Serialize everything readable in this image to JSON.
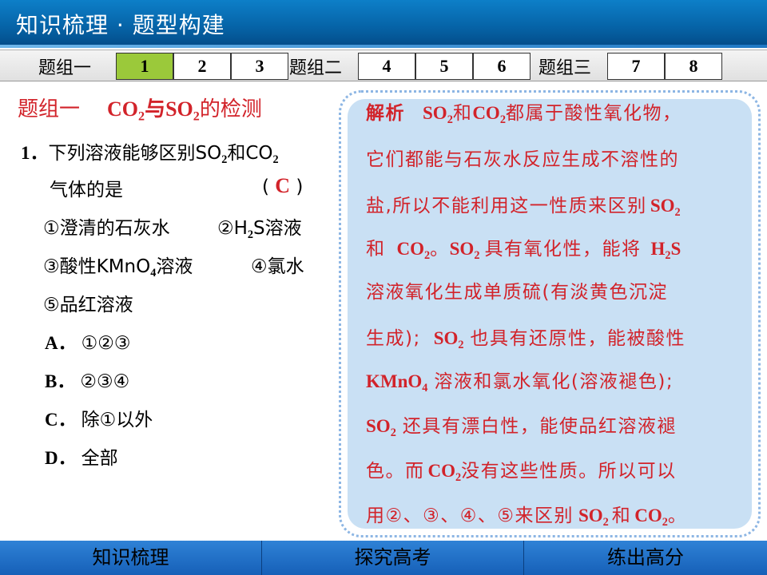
{
  "header": {
    "title": "知识梳理 · 题型构建"
  },
  "tabbar": {
    "groups": [
      {
        "label": "题组一",
        "tabs": [
          "1",
          "2",
          "3"
        ]
      },
      {
        "label": "题组二",
        "tabs": [
          "4",
          "5",
          "6"
        ]
      },
      {
        "label": "题组三",
        "tabs": [
          "7",
          "8"
        ]
      }
    ],
    "active_tab": "1"
  },
  "section": {
    "group": "题组一",
    "title_pre": "CO",
    "title_sub1": "2",
    "title_mid": "与SO",
    "title_sub2": "2",
    "title_post": "的检测"
  },
  "question": {
    "number": "1．",
    "stem_a": "下列溶液能够区别SO",
    "stem_sub1": "2",
    "stem_b": "和CO",
    "stem_sub2": "2",
    "stem_line2": "气体的是",
    "paren_open": "(",
    "answer": "C",
    "paren_close": ")",
    "item1": "①澄清的石灰水",
    "item2_pre": "②H",
    "item2_sub": "2",
    "item2_post": "S溶液",
    "item3_pre": "③酸性KMnO",
    "item3_sub": "4",
    "item3_post": "溶液",
    "item4": "④氯水",
    "item5": "⑤品红溶液",
    "options": [
      {
        "letter": "A．",
        "text": "①②③"
      },
      {
        "letter": "B．",
        "text": "②③④"
      },
      {
        "letter": "C．",
        "text": "除①以外"
      },
      {
        "letter": "D．",
        "text": "全部"
      }
    ]
  },
  "analysis": {
    "lead": "解析",
    "l1a": "SO",
    "l1s1": "2",
    "l1b": "和",
    "l1c": "CO",
    "l1s2": "2",
    "l1d": "都属于酸性氧化物，",
    "l2": "它们都能与石灰水反应生成不溶性的",
    "l3a": "盐,所以不能利用这一性质来区别",
    "l3b": "SO",
    "l3s": "2",
    "l4a": "和",
    "l4b": "CO",
    "l4s": "2",
    "l4c": "。",
    "l4d": "SO",
    "l4s2": "2",
    "l4e": "具有氧化性，能将",
    "l4f": "H",
    "l4s3": "2",
    "l4g": "S",
    "l5": "溶液氧化生成单质硫(有淡黄色沉淀",
    "l6a": "生成);",
    "l6b": "SO",
    "l6s": "2",
    "l6c": "也具有还原性，能被酸性",
    "l7a": "KMnO",
    "l7s": "4",
    "l7b": "溶液和氯水氧化(溶液褪色);",
    "l8a": "SO",
    "l8s": "2",
    "l8b": "还具有漂白性，能使品红溶液褪",
    "l9a": "色。而",
    "l9b": "CO",
    "l9s": "2",
    "l9c": "没有这些性质。所以可以",
    "l10a": "用②、③、④、⑤来区别",
    "l10b": "SO",
    "l10s": "2",
    "l10c": "和",
    "l10d": "CO",
    "l10s2": "2",
    "l10e": "。"
  },
  "footer": {
    "items": [
      "知识梳理",
      "探究高考",
      "练出高分"
    ]
  },
  "colors": {
    "accent_red": "#d2232a",
    "header_blue": "#0664a8",
    "active_tab": "#9bc93a",
    "analysis_bg": "#c9e0f4"
  }
}
